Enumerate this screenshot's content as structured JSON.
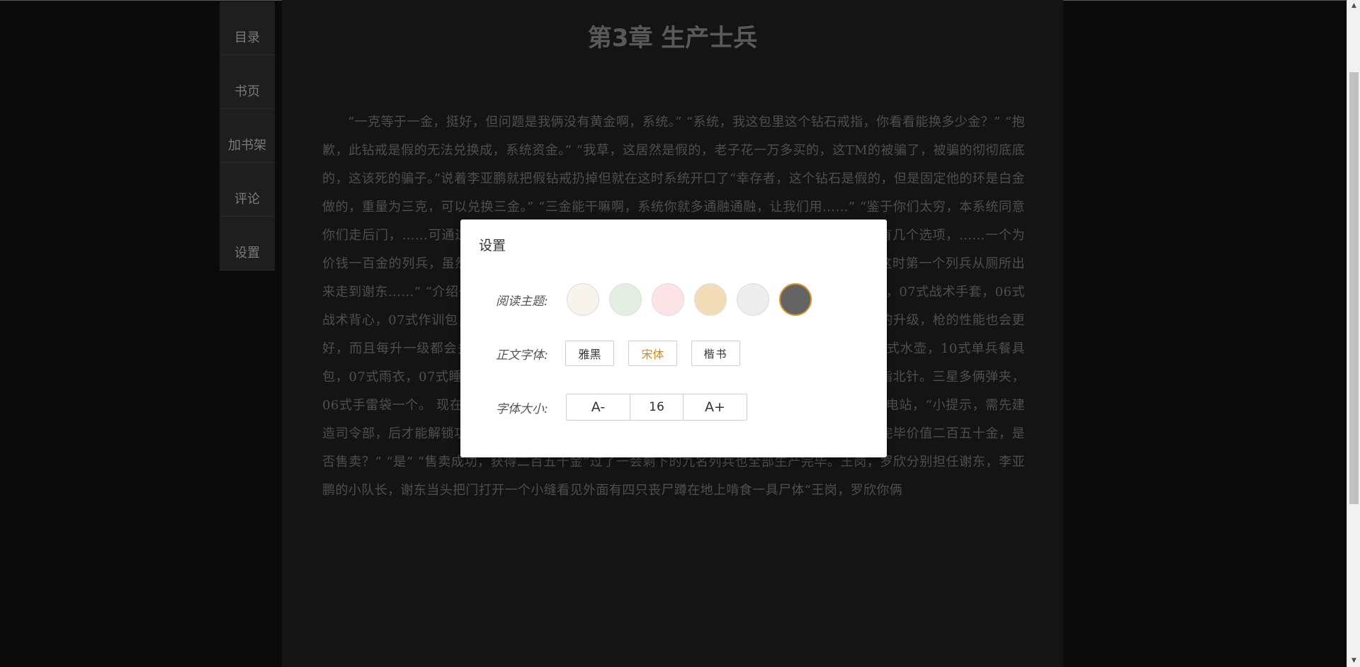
{
  "sidebar": {
    "items": [
      {
        "label": "目录"
      },
      {
        "label": "书页"
      },
      {
        "label": "加书架"
      },
      {
        "label": "评论"
      },
      {
        "label": "设置"
      }
    ]
  },
  "chapter": {
    "title": "第3章 生产士兵",
    "body": "“一克等于一金，挺好，但问题是我俩没有黄金啊，系统。” “系统，我这包里这个钻石戒指，你看看能换多少金？” “抱歉，此钻戒是假的无法兑换成，系统资金。” “我草，这居然是假的，老子花一万多买的，这TM的被骗了，被骗的彻彻底底的，这该死的骗子。”说着李亚鹏就把假钻戒扔掉但就在这时系统开口了“幸存者，这个钻石是假的，但是固定他的环是白金做的，重量为三克，可以兑换三金。” “三金能干嘛啊，系统你就多通融通融，让我们用……” “鉴于你们太穷，本系统同意你们走后门，……可通过交易站出售换金，注意本系统只为你……时系统自动打开主界面，上面有几个选项，……一个为价钱一百金的列兵，虽然只有一百但……打开后都获得了初始资金一千五百金，两人……怀疑。这时第一个列兵从厕所出来走到谢东……” “介绍一下你自己” “是，我叫王岗，……式装带，06式护时护膝盖”07式作战靴，07式战术手套，06式战术背心，07式作训包，但带的枪是八一杠，因为我们带的枪是指挥官心理最喜欢的，但随着我的升级，枪的性能也会更好，而且每升一级都会多加些物品。一星时我们有两个弹夹（枪上自带一个，弹夹袋一个），07式水壶，10式单兵餐具包，07式雨衣，07式睡袋，多用途刺刀。二星多一个弹夹，一具防毒面具，06式手雷袋，97式指北针。三星多俩弹夹，06式手雷袋一个。 现在两人各剩一千金，李亚鹏点开建造界面发现所有建筑都是灰色的，点击发电站，“小提示，需先建造司令部，后才能解锁功能类建筑。” “哦，系统你看看这把手枪值多少金？” “系统评估中，评估完毕价值二百五十金，是否售卖？” “是” “售卖成功，获得二百五十金”过了一会剩下的九名列兵也全部生产完毕。王岗，罗欣分别担任谢东，李亚鹏的小队长，谢东当头把门打开一个小缝看见外面有四只丧尸蹲在地上啃食一具尸体“王岗，罗欣你俩"
  },
  "settings": {
    "title": "设置",
    "theme_label": "阅读主题:",
    "themes": [
      {
        "color": "#f8f4ec"
      },
      {
        "color": "#e3efe1"
      },
      {
        "color": "#fde3e5"
      },
      {
        "color": "#f2ddb8"
      },
      {
        "color": "#ededed"
      },
      {
        "color": "#646464"
      }
    ],
    "active_theme": 5,
    "font_label": "正文字体:",
    "fonts": [
      {
        "label": "雅黑"
      },
      {
        "label": "宋体"
      },
      {
        "label": "楷书"
      }
    ],
    "active_font": 1,
    "size_label": "字体大小:",
    "size_decrease": "A-",
    "size_value": "16",
    "size_increase": "A+"
  }
}
